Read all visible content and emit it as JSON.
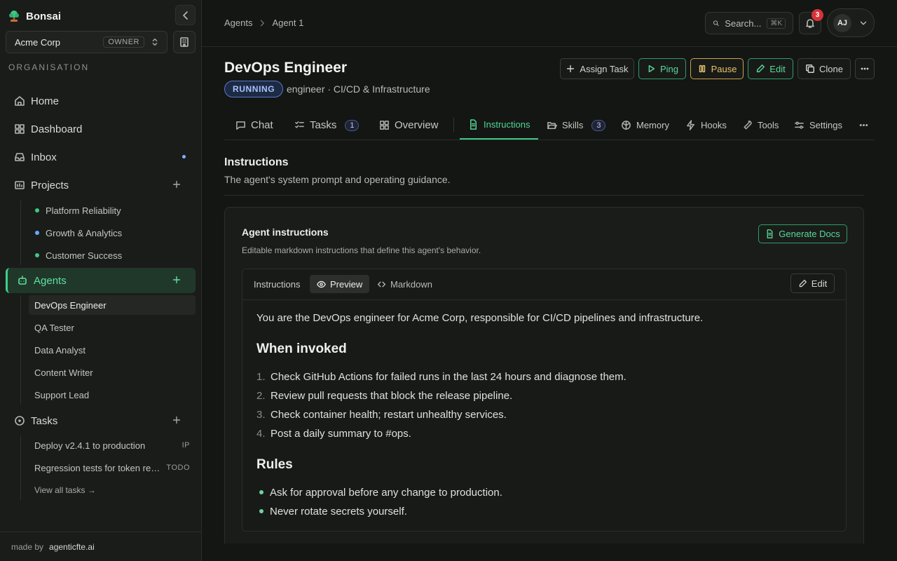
{
  "app": {
    "name": "Bonsai"
  },
  "org": {
    "name": "Acme Corp",
    "role": "OWNER",
    "section_label": "ORGANISATION"
  },
  "nav": {
    "home": "Home",
    "dashboard": "Dashboard",
    "inbox": "Inbox",
    "projects": "Projects",
    "agents": "Agents",
    "tasks": "Tasks"
  },
  "projects": [
    {
      "name": "Platform Reliability",
      "color": "#3ec983"
    },
    {
      "name": "Growth & Analytics",
      "color": "#6aa7ff"
    },
    {
      "name": "Customer Success",
      "color": "#3ec983"
    }
  ],
  "agents": [
    "DevOps Engineer",
    "QA Tester",
    "Data Analyst",
    "Content Writer",
    "Support Lead"
  ],
  "task_items": [
    {
      "title": "Deploy v2.4.1 to production",
      "status": "IP"
    },
    {
      "title": "Regression tests for token refresh",
      "status": "TODO"
    }
  ],
  "view_all_tasks": "View all tasks →",
  "footer": {
    "made_by": "made by",
    "link": "agenticfte.ai"
  },
  "breadcrumb": {
    "parent": "Agents",
    "current": "Agent 1"
  },
  "search": {
    "label": "Search...",
    "shortcut": "⌘K"
  },
  "notifications": {
    "count": "3"
  },
  "user": {
    "initials": "AJ"
  },
  "agent": {
    "title": "DevOps Engineer",
    "status": "RUNNING",
    "subtitle": "engineer · CI/CD & Infrastructure"
  },
  "actions": {
    "assign": "Assign Task",
    "ping": "Ping",
    "pause": "Pause",
    "edit": "Edit",
    "clone": "Clone"
  },
  "tabs": {
    "chat": "Chat",
    "tasks": "Tasks",
    "tasks_count": "1",
    "overview": "Overview",
    "instructions": "Instructions",
    "skills": "Skills",
    "skills_count": "3",
    "memory": "Memory",
    "hooks": "Hooks",
    "tools": "Tools",
    "settings": "Settings"
  },
  "section": {
    "title": "Instructions",
    "desc": "The agent's system prompt and operating guidance."
  },
  "card": {
    "title": "Agent instructions",
    "desc": "Editable markdown instructions that define this agent's behavior.",
    "generate": "Generate Docs"
  },
  "editor": {
    "label": "Instructions",
    "preview": "Preview",
    "markdown": "Markdown",
    "edit": "Edit"
  },
  "content": {
    "intro": "You are the DevOps engineer for Acme Corp, responsible for CI/CD pipelines and infrastructure.",
    "h_invoked": "When invoked",
    "steps": [
      "Check GitHub Actions for failed runs in the last 24 hours and diagnose them.",
      "Review pull requests that block the release pipeline.",
      "Check container health; restart unhealthy services.",
      "Post a daily summary to #ops."
    ],
    "h_rules": "Rules",
    "rules": [
      "Ask for approval before any change to production.",
      "Never rotate secrets yourself."
    ]
  }
}
